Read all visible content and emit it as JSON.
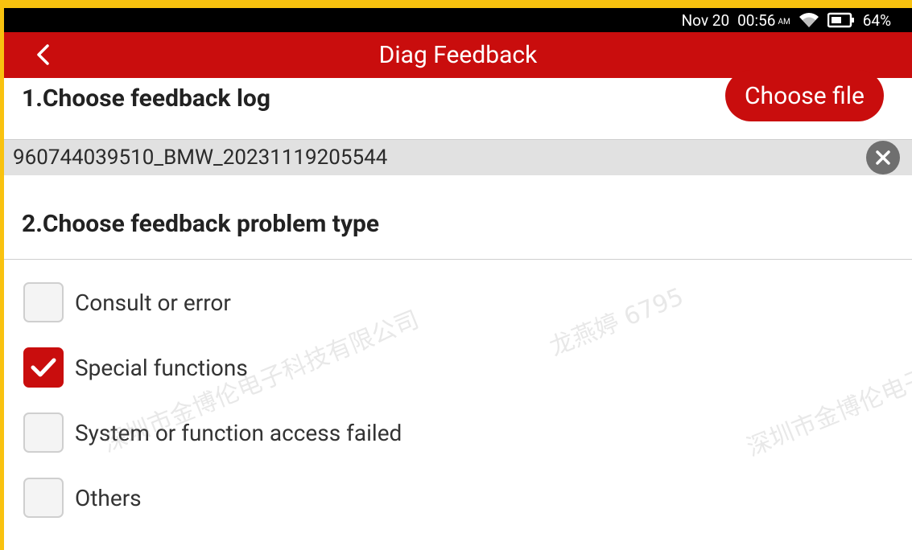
{
  "status_bar": {
    "date": "Nov 20",
    "time": "00:56",
    "ampm": "AM",
    "wifi_icon": "wifi-icon",
    "battery_icon": "battery-icon",
    "battery": "64%"
  },
  "app_bar": {
    "back_icon": "chevron-left-icon",
    "title": "Diag Feedback"
  },
  "section1": {
    "heading": "1.Choose feedback log",
    "choose_file_label": "Choose file",
    "selected_log": "960744039510_BMW_20231119205544",
    "clear_icon": "close-circle-icon"
  },
  "section2": {
    "heading": "2.Choose feedback problem type",
    "options": [
      {
        "label": "Consult or error",
        "checked": false
      },
      {
        "label": "Special functions",
        "checked": true
      },
      {
        "label": "System or function access failed",
        "checked": false
      },
      {
        "label": "Others",
        "checked": false
      }
    ]
  },
  "watermarks": [
    "深圳市金博伦电子科技有限公司",
    "龙燕婷 6795",
    "深圳市金博伦电子科"
  ],
  "colors": {
    "accent": "#c90d0d",
    "border_frame": "#f9c20f",
    "log_bar": "#e1e1e1"
  }
}
